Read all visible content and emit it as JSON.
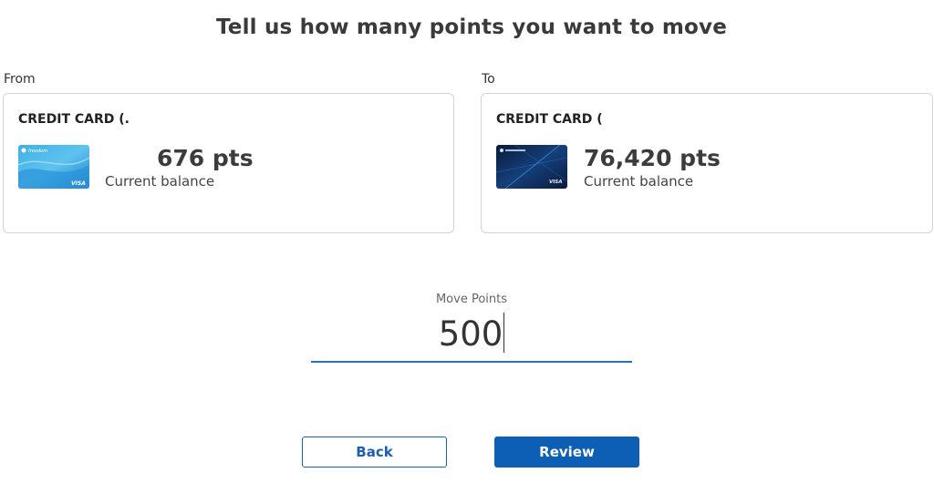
{
  "page": {
    "title": "Tell us how many points you want to move"
  },
  "from": {
    "label": "From",
    "card_name": "CREDIT CARD (.",
    "points": "676 pts",
    "balance_label": "Current balance",
    "card_brand_text": "freedom",
    "card_network": "VISA"
  },
  "to": {
    "label": "To",
    "card_name": "CREDIT CARD (",
    "points": "76,420 pts",
    "balance_label": "Current balance",
    "card_network": "VISA"
  },
  "move": {
    "label": "Move Points",
    "value": "500"
  },
  "actions": {
    "back_label": "Back",
    "review_label": "Review"
  },
  "colors": {
    "accent": "#0d5fb5",
    "underline": "#2a6fba",
    "border": "#d4d4d4"
  }
}
